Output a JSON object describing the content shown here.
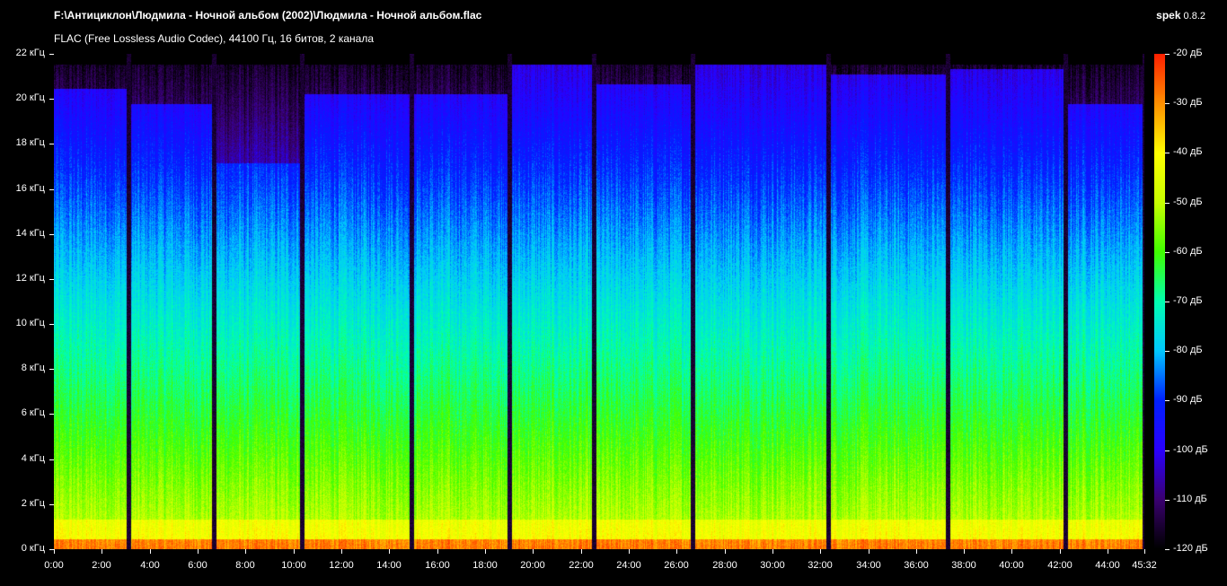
{
  "header": {
    "file_title": "F:\\Антициклон\\Людмила - Ночной альбом (2002)\\Людмила - Ночной альбом.flac",
    "file_info": "FLAC (Free Lossless Audio Codec), 44100 Гц, 16 битов, 2 канала",
    "app_name": "spek",
    "app_version": "0.8.2"
  },
  "chart_data": {
    "type": "heatmap",
    "x_axis": {
      "min_seconds": 0,
      "max_seconds": 2732,
      "tick_labels": [
        "0:00",
        "2:00",
        "4:00",
        "6:00",
        "8:00",
        "10:00",
        "12:00",
        "14:00",
        "16:00",
        "18:00",
        "20:00",
        "22:00",
        "24:00",
        "26:00",
        "28:00",
        "30:00",
        "32:00",
        "34:00",
        "36:00",
        "38:00",
        "40:00",
        "42:00",
        "44:00",
        "45:32"
      ]
    },
    "y_axis": {
      "min_khz": 0,
      "max_khz": 22,
      "tick_labels": [
        "0 кГц",
        "2 кГц",
        "4 кГц",
        "6 кГц",
        "8 кГц",
        "10 кГц",
        "12 кГц",
        "14 кГц",
        "16 кГц",
        "18 кГц",
        "20 кГц",
        "22 кГц"
      ]
    },
    "color_scale": {
      "min_db": -120,
      "max_db": -20,
      "tick_labels": [
        "-20 дБ",
        "-30 дБ",
        "-40 дБ",
        "-50 дБ",
        "-60 дБ",
        "-70 дБ",
        "-80 дБ",
        "-90 дБ",
        "-100 дБ",
        "-110 дБ",
        "-120 дБ"
      ],
      "colors": [
        "#000000",
        "#3a0070",
        "#2a00ff",
        "#0020ff",
        "#00c8ff",
        "#00ffb0",
        "#40ff00",
        "#c8ff00",
        "#ffff00",
        "#ff9000",
        "#ff2000"
      ]
    },
    "track_boundaries_seconds": [
      187,
      400,
      620,
      895,
      1140,
      1352,
      1600,
      1940,
      2240,
      2535,
      2733
    ]
  }
}
